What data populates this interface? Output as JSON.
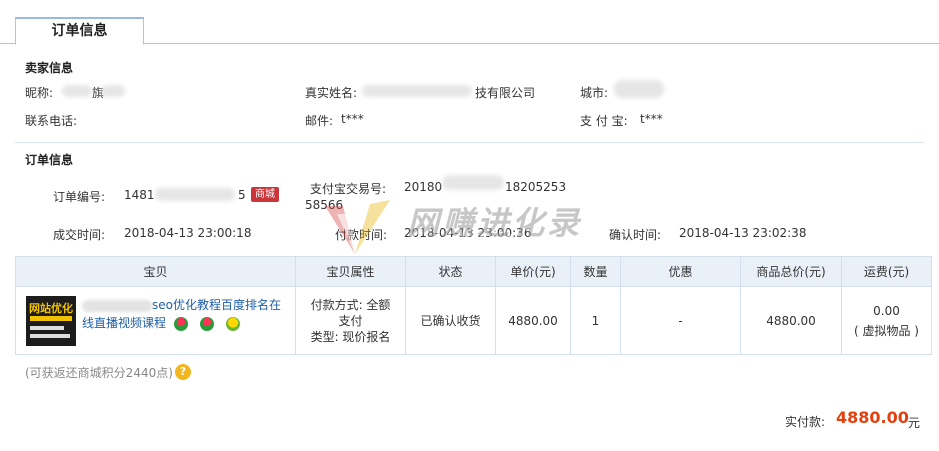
{
  "tab": {
    "label": "订单信息"
  },
  "seller": {
    "section_title": "卖家信息",
    "nickname_label": "昵称:",
    "nickname_value": "旗",
    "realname_label": "真实姓名:",
    "realname_value": "技有限公司",
    "city_label": "城市:",
    "phone_label": "联系电话:",
    "email_label": "邮件:",
    "email_value": "t***",
    "alipay_label": "支 付 宝:",
    "alipay_value": "t***"
  },
  "order": {
    "section_title": "订单信息",
    "order_no_label": "订单编号:",
    "order_no_prefix": "1481",
    "order_no_suffix": "5",
    "mall_badge": "商城",
    "alipay_trade_label": "支付宝交易号:",
    "alipay_trade_prefix": "20180",
    "alipay_trade_mid": "18205253",
    "alipay_trade_line2": "58566",
    "deal_time_label": "成交时间:",
    "deal_time": "2018-04-13 23:00:18",
    "pay_time_label": "付款时间:",
    "pay_time": "2018-04-13 23:00:36",
    "confirm_time_label": "确认时间:",
    "confirm_time": "2018-04-13 23:02:38"
  },
  "watermark": {
    "text": "网赚进化录"
  },
  "table": {
    "headers": [
      "宝贝",
      "宝贝属性",
      "状态",
      "单价(元)",
      "数量",
      "优惠",
      "商品总价(元)",
      "运费(元)"
    ],
    "row": {
      "thumb_text": "网站优化",
      "name_line1": "seo优化教程百度排名在",
      "name_line2": "线直播视频课程",
      "attr_line1": "付款方式: 全额",
      "attr_line2": "支付",
      "attr_line3": "类型: 现价报名",
      "status": "已确认收货",
      "unit_price": "4880.00",
      "quantity": "1",
      "discount": "-",
      "total": "4880.00",
      "shipping_line1": "0.00",
      "shipping_line2": "( 虚拟物品 )"
    }
  },
  "points_note": "(可获返还商城积分2440点)",
  "help_icon": "?",
  "summary": {
    "paid_label": "实付款:",
    "paid_value": "4880.00",
    "unit": "元"
  },
  "colors": {
    "accent": "#e4400e",
    "link": "#1f5ea8",
    "badge": "#c9353b",
    "header_bg": "#e9f0f8"
  }
}
